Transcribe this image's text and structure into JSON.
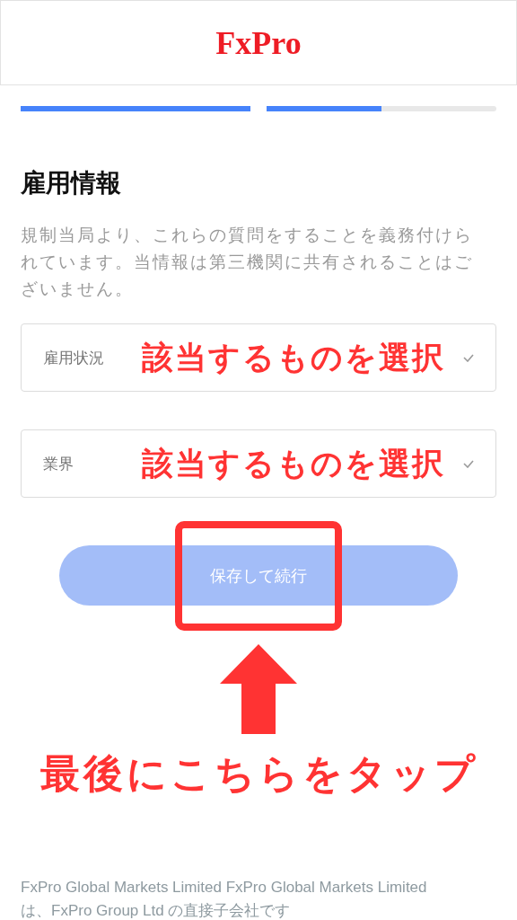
{
  "header": {
    "logo": "FxPro"
  },
  "progress": [
    {
      "level": 1
    },
    {
      "level": 0.5
    }
  ],
  "section": {
    "title": "雇用情報",
    "description": "規制当局より、これらの質問をすることを義務付けられています。当情報は第三機関に共有されることはございません。"
  },
  "fields": [
    {
      "label": "雇用状況",
      "annotation": "該当するものを選択"
    },
    {
      "label": "業界",
      "annotation": "該当するものを選択"
    }
  ],
  "submit": {
    "label": "保存して続行",
    "disabled": true
  },
  "callout": {
    "caption": "最後にこちらをタップ"
  },
  "footer": {
    "text": "FxPro Global Markets Limited FxPro Global Markets Limited は、FxPro Group Ltd の直接子会社です"
  }
}
